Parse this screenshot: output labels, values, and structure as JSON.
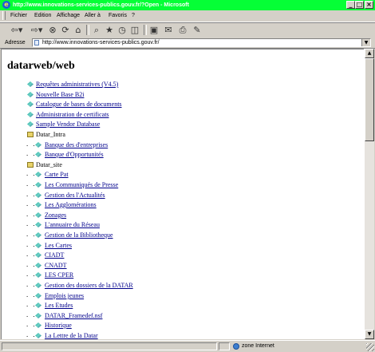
{
  "window": {
    "title": "http://www.innovations-services-publics.gouv.fr/?Open - Microsoft",
    "minimize": "_",
    "maximize": "□",
    "close": "×"
  },
  "menu": [
    {
      "label": "Fichier"
    },
    {
      "label": "Edition"
    },
    {
      "label": "Affichage"
    },
    {
      "label": "Aller à"
    },
    {
      "label": "Favoris"
    },
    {
      "label": "?"
    }
  ],
  "toolbar": {
    "buttons": [
      {
        "name": "back-icon",
        "glyph": "⇦▾"
      },
      {
        "name": "forward-icon",
        "glyph": "⇨▾"
      },
      {
        "name": "stop-icon",
        "glyph": "⊗"
      },
      {
        "name": "refresh-icon",
        "glyph": "⟳"
      },
      {
        "name": "home-icon",
        "glyph": "⌂"
      },
      {
        "name": "search-icon",
        "glyph": "⌕"
      },
      {
        "name": "favorites-icon",
        "glyph": "★"
      },
      {
        "name": "history-icon",
        "glyph": "◷"
      },
      {
        "name": "channels-icon",
        "glyph": "◫"
      },
      {
        "name": "fullscreen-icon",
        "glyph": "▣"
      },
      {
        "name": "mail-icon",
        "glyph": "✉"
      },
      {
        "name": "print-icon",
        "glyph": "⎙"
      },
      {
        "name": "edit-icon",
        "glyph": "✎"
      }
    ]
  },
  "address": {
    "label": "Adresse",
    "value": "http://www.innovations-services-publics.gouv.fr/"
  },
  "page": {
    "title": "datarweb/web",
    "tree": [
      {
        "dots": "",
        "icon": "doc",
        "label": "Requêtes administratives (V4.5)",
        "link": true
      },
      {
        "dots": "",
        "icon": "doc",
        "label": "Nouvelle Base B2i",
        "link": true
      },
      {
        "dots": "",
        "icon": "doc",
        "label": "Catalogue de bases de documents",
        "link": true
      },
      {
        "dots": "",
        "icon": "doc",
        "label": "Administration de certificats",
        "link": true
      },
      {
        "dots": "",
        "icon": "doc",
        "label": "Sample Vendor Database",
        "link": true
      },
      {
        "dots": "",
        "icon": "folder",
        "label": "Datar_Intra",
        "link": false
      },
      {
        "dots": ". .",
        "icon": "doc",
        "label": "Banque des d'entreprises",
        "link": true
      },
      {
        "dots": ". .",
        "icon": "doc",
        "label": "Banque d'Opportunités",
        "link": true
      },
      {
        "dots": "",
        "icon": "folder",
        "label": "Datar_site",
        "link": false
      },
      {
        "dots": ". .",
        "icon": "doc",
        "label": "Carte Pat",
        "link": true
      },
      {
        "dots": ". .",
        "icon": "doc",
        "label": "Les Communiqués de Presse",
        "link": true
      },
      {
        "dots": ". .",
        "icon": "doc",
        "label": "Gestion des l'Actualités",
        "link": true
      },
      {
        "dots": ". .",
        "icon": "doc",
        "label": "Les Agglomérations",
        "link": true
      },
      {
        "dots": ". .",
        "icon": "doc",
        "label": "Zonages",
        "link": true
      },
      {
        "dots": ". .",
        "icon": "doc",
        "label": "L'annuaire du Réseau",
        "link": true
      },
      {
        "dots": ". .",
        "icon": "doc",
        "label": "Gestion de la Bibliotheque",
        "link": true
      },
      {
        "dots": ". .",
        "icon": "doc",
        "label": "Les Cartes",
        "link": true
      },
      {
        "dots": ". .",
        "icon": "doc",
        "label": "CIADT",
        "link": true
      },
      {
        "dots": ". .",
        "icon": "doc",
        "label": "CNADT",
        "link": true
      },
      {
        "dots": ". .",
        "icon": "doc",
        "label": "LES CPER",
        "link": true
      },
      {
        "dots": ". .",
        "icon": "doc",
        "label": "Gestion des dossiers de la DATAR",
        "link": true
      },
      {
        "dots": ". .",
        "icon": "doc",
        "label": "Emplois jeunes",
        "link": true
      },
      {
        "dots": ". .",
        "icon": "doc",
        "label": "Les Etudes",
        "link": true
      },
      {
        "dots": ". .",
        "icon": "doc",
        "label": "DATAR_Framedef.nsf",
        "link": true
      },
      {
        "dots": ". .",
        "icon": "doc",
        "label": "Historique",
        "link": true
      },
      {
        "dots": ". .",
        "icon": "doc",
        "label": "La Lettre de la Datar",
        "link": true
      }
    ]
  },
  "scrollbar": {
    "up": "▲",
    "down": "▼"
  },
  "status": {
    "zone": "zone Internet"
  },
  "colors": {
    "titlebar": "#05ff36",
    "link": "#00008b",
    "chrome": "#d4d0c8"
  }
}
